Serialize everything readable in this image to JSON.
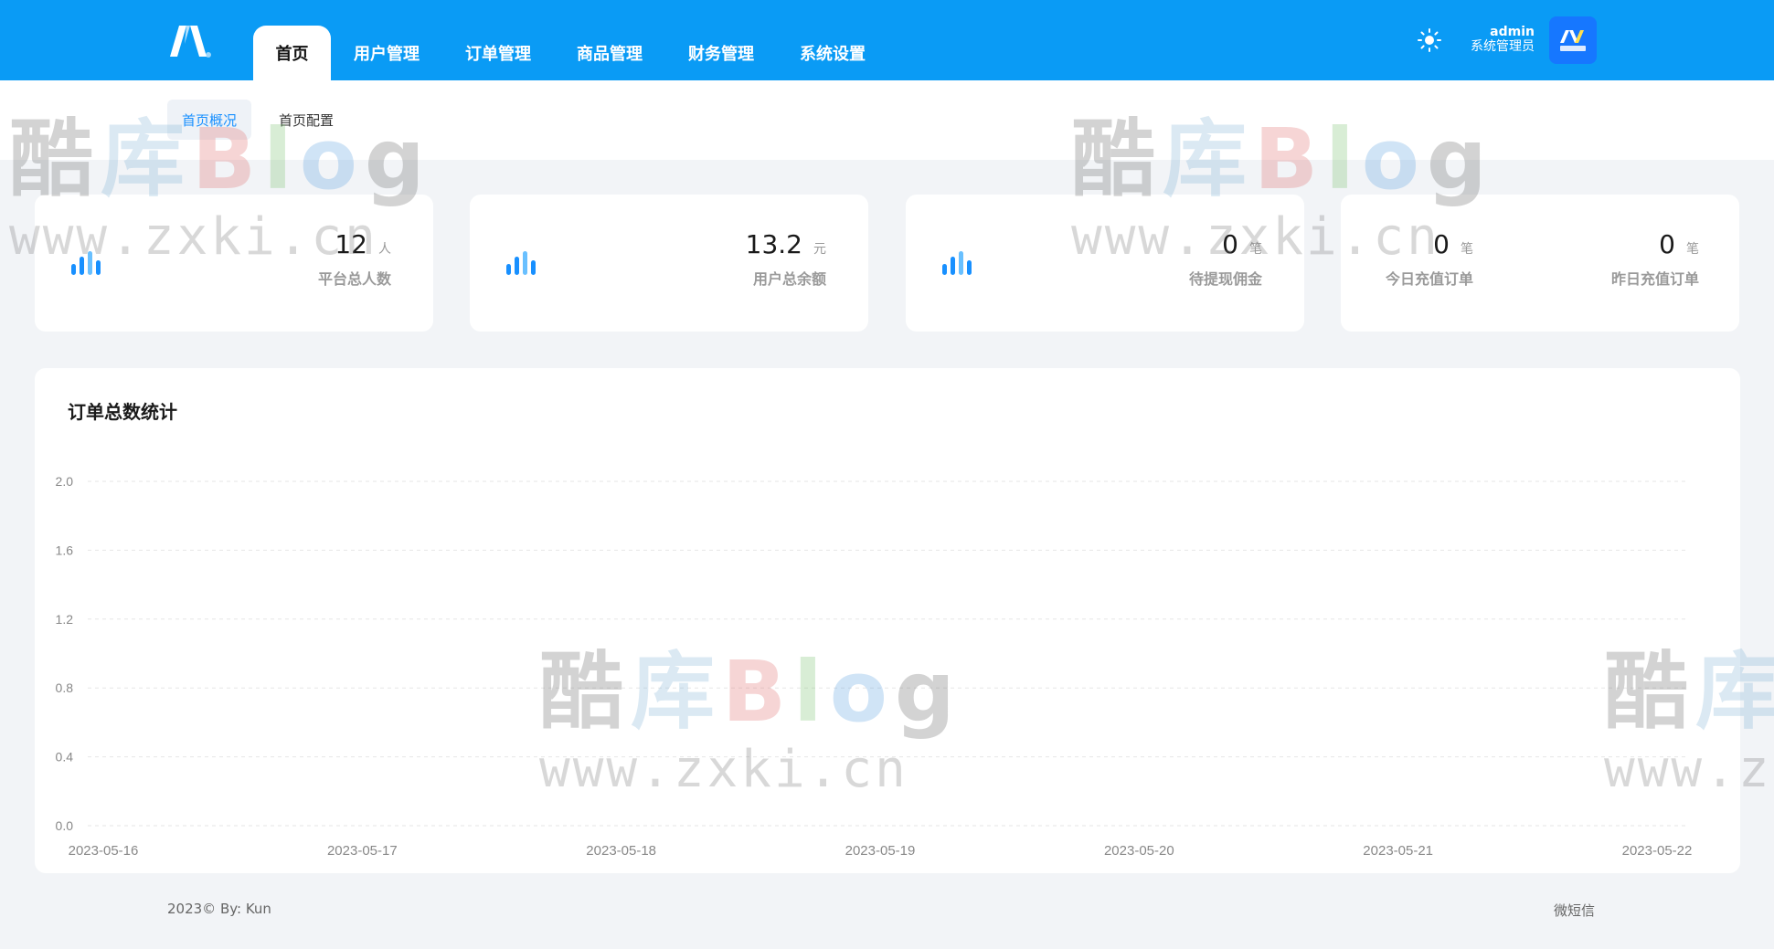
{
  "topbar": {
    "bg_color": "#0a9bf5",
    "nav_tabs": [
      {
        "label": "首页",
        "active": true
      },
      {
        "label": "用户管理",
        "active": false
      },
      {
        "label": "订单管理",
        "active": false
      },
      {
        "label": "商品管理",
        "active": false
      },
      {
        "label": "财务管理",
        "active": false
      },
      {
        "label": "系统设置",
        "active": false
      }
    ],
    "theme_icon": "sun-icon",
    "user": {
      "name": "admin",
      "role": "系统管理员"
    }
  },
  "subnav": {
    "tabs": [
      {
        "label": "首页概况",
        "active": true
      },
      {
        "label": "首页配置",
        "active": false
      }
    ]
  },
  "stats": [
    {
      "value": "12",
      "unit": "人",
      "label": "平台总人数"
    },
    {
      "value": "13.2",
      "unit": "元",
      "label": "用户总余额"
    },
    {
      "value": "0",
      "unit": "笔",
      "label": "待提现佣金"
    },
    {
      "value": "0",
      "unit": "笔",
      "label": "今日充值订单"
    },
    {
      "value": "0",
      "unit": "笔",
      "label": "昨日充值订单"
    }
  ],
  "chart_title": "订单总数统计",
  "chart_data": {
    "type": "line",
    "title": "订单总数统计",
    "categories": [
      "2023-05-16",
      "2023-05-17",
      "2023-05-18",
      "2023-05-19",
      "2023-05-20",
      "2023-05-21",
      "2023-05-22"
    ],
    "y_ticks": [
      "0.0",
      "0.4",
      "0.8",
      "1.2",
      "1.6",
      "2.0"
    ],
    "ylim": [
      0,
      2
    ],
    "grid": true,
    "series": []
  },
  "footer": {
    "left": "2023© By: Kun",
    "right": "微短信"
  },
  "watermark": {
    "brand": "酷库Blog",
    "url": "www.zxki.cn"
  }
}
